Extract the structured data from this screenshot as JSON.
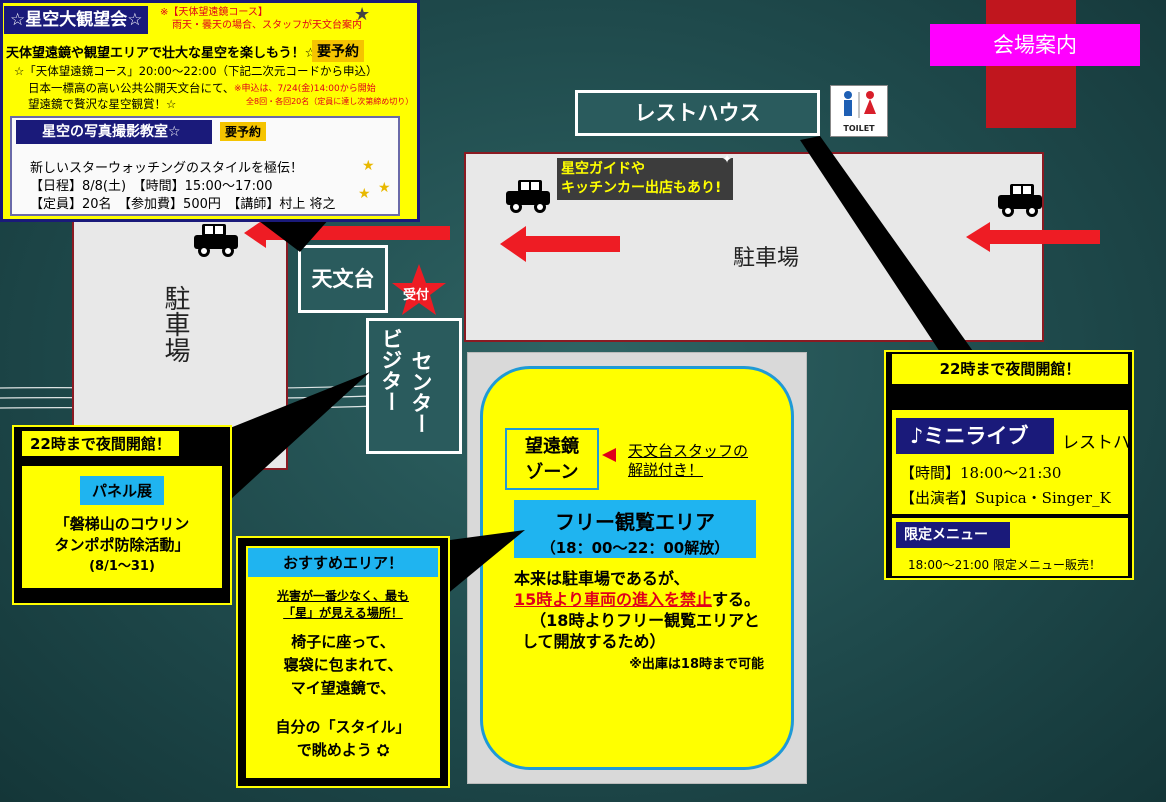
{
  "header": {
    "venue_guide": "会場案内"
  },
  "event_box": {
    "title": "☆星空大観望会☆",
    "note_line1": "※【天体望遠鏡コース】",
    "note_line2": "雨天・曇天の場合、スタッフが天文台案内",
    "lead": "天体望遠鏡や観望エリアで壮大な星空を楽しもう！☆",
    "reserve": "要予約",
    "course": "☆「天体望遠鏡コース」20:00～22:00（下記二次元コードから申込）",
    "desc_line1": "日本一標高の高い公共公開天文台にて、",
    "desc_line2": "望遠鏡で贅沢な星空観賞！☆",
    "apply_note1": "※申込は、7/24(金)14:00から開始",
    "apply_note2": "全8回・各回20名（定員に達し次第締め切り）"
  },
  "photo_class": {
    "title": "星空の写真撮影教室☆",
    "reserve": "要予約",
    "line1": "新しいスターウォッチングのスタイルを極伝！",
    "line2": "【日程】8/8(土)　【時間】15:00～17:00",
    "line3": "【定員】20名　【参加費】500円　【講師】村上 将之"
  },
  "map": {
    "observatory": "天文台",
    "reception": "受付",
    "visitor_line1": "ビジター",
    "visitor_line2": "センター",
    "parking_left": "駐車場",
    "parking_top": "駐車場",
    "rest_house": "レストハウス",
    "toilet": "TOILET",
    "kitchen_line1": "星空ガイドや",
    "kitchen_line2": "キッチンカー出店もあり!"
  },
  "telescope_area": {
    "zone_line1": "望遠鏡",
    "zone_line2": "ゾーン",
    "staff_line1": "天文台スタッフの",
    "staff_line2": "解説付き！",
    "free_title": "フリー観覧エリア",
    "free_hours": "（18：00～22：00解放）",
    "text1": "本来は駐車場であるが、",
    "text2_red": "15時より車両の進入を禁止",
    "text2_after": "する。",
    "text3": "（18時よりフリー観覧エリアと",
    "text4": "して開放するため）",
    "note": "※出庫は18時まで可能"
  },
  "visitor_callout": {
    "headline": "22時まで夜間開館！",
    "panel_label": "パネル展",
    "line1": "「磐梯山のコウリン",
    "line2": "タンポポ防除活動」",
    "dates": "(8/1～31)"
  },
  "recommend_callout": {
    "title": "おすすめエリア！",
    "sub1": "光害が一番少なく、最も",
    "sub2": "「星」が見える場所！",
    "line1": "椅子に座って、",
    "line2": "寝袋に包まれて、",
    "line3": "マイ望遠鏡で、",
    "line4": "自分の「スタイル」",
    "line5": "で眺めよう"
  },
  "resthouse_callout": {
    "headline": "22時まで夜間開館！",
    "live_title": "♪ミニライブ",
    "live_place": "レストハ",
    "time": "【時間】18:00～21:30",
    "performers": "【出演者】Supica・Singer_K",
    "menu_title": "限定メニュー",
    "menu_desc": "18:00～21:00 限定メニュー販売！"
  }
}
